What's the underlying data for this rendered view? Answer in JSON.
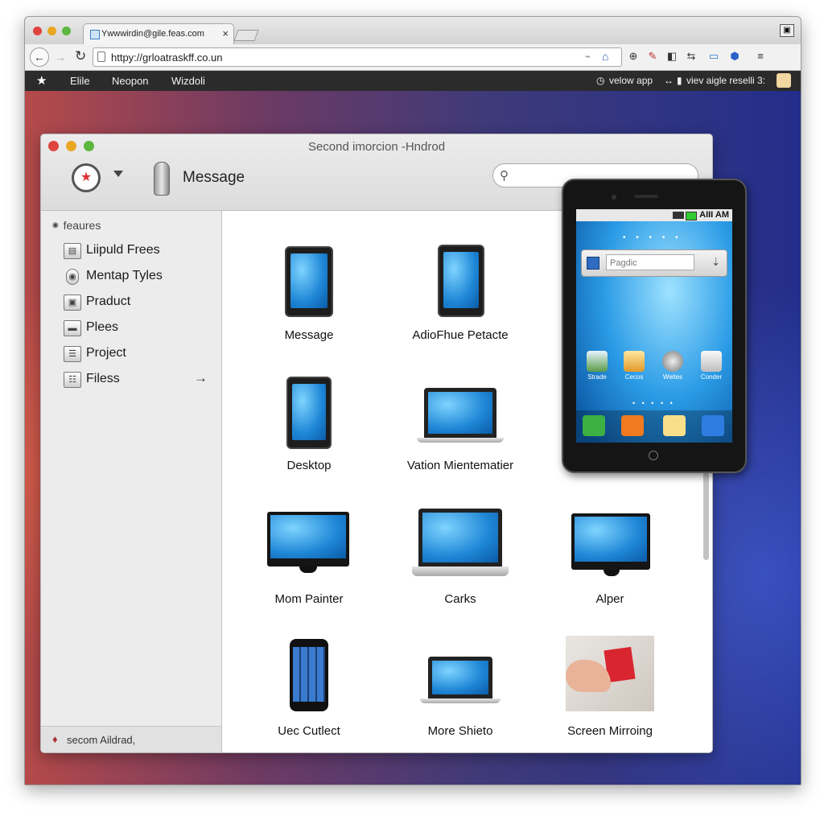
{
  "browser": {
    "tab_title": "Ywwwirdin@gile.feas.com",
    "tab_close": "×",
    "url": "httpy://grloatraskff.co.un",
    "bookmarks": [
      "Elile",
      "Neopon",
      "Wizdoli"
    ],
    "bookmarks_right": [
      "velow app",
      "viev aigle reselli 3:"
    ]
  },
  "app": {
    "title": "Second imorcion  -Hndrod",
    "toolbar_label": "Message",
    "search_placeholder": ""
  },
  "sidebar": {
    "header": "feaures",
    "items": [
      {
        "label": "Liipuld Frees",
        "icon": "folder-icon"
      },
      {
        "label": "Mentap Tyles",
        "icon": "lock-icon"
      },
      {
        "label": "Praduct",
        "icon": "image-icon"
      },
      {
        "label": "Plees",
        "icon": "folder-icon"
      },
      {
        "label": "Project",
        "icon": "scroll-icon"
      },
      {
        "label": "Filess",
        "icon": "file-icon"
      }
    ],
    "footer": "secom Aildrad,"
  },
  "grid": {
    "items": [
      {
        "label": "Message",
        "device": "tablet"
      },
      {
        "label": "AdioFhue Petacte",
        "device": "tablet"
      },
      {
        "label": "Desktop",
        "device": "tablet"
      },
      {
        "label": "Vation Mientematier",
        "device": "laptop"
      },
      {
        "label": "Mom Painter",
        "device": "monitor"
      },
      {
        "label": "Carks",
        "device": "laptop"
      },
      {
        "label": "Alper",
        "device": "monitor"
      },
      {
        "label": "Uec Cutlect",
        "device": "phone"
      },
      {
        "label": "More Shieto",
        "device": "laptop"
      },
      {
        "label": "Screen Mirroing",
        "device": "photo"
      }
    ]
  },
  "phone": {
    "time": "AIII AM",
    "search_placeholder": "Pagdic",
    "apps": [
      "Strade",
      "Cecos",
      "Weites",
      "Conder"
    ]
  }
}
